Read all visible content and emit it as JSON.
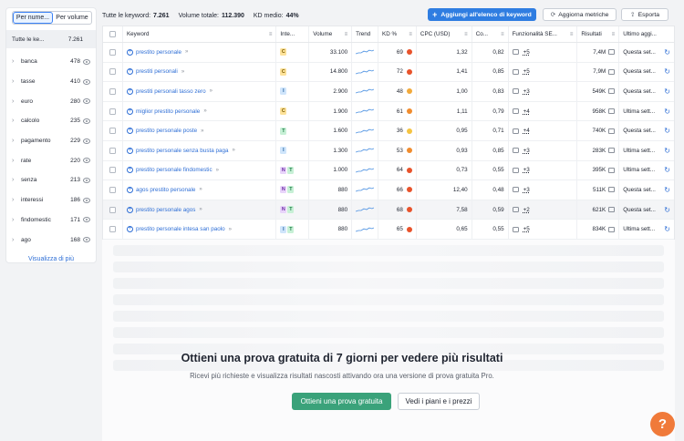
{
  "sidebar": {
    "tabs": [
      {
        "label": "Per nume..."
      },
      {
        "label": "Per volume"
      }
    ],
    "all_label": "Tutte le ke...",
    "all_count": "7.261",
    "items": [
      {
        "label": "banca",
        "count": "478"
      },
      {
        "label": "tasse",
        "count": "410"
      },
      {
        "label": "euro",
        "count": "280"
      },
      {
        "label": "calcolo",
        "count": "235"
      },
      {
        "label": "pagamento",
        "count": "229"
      },
      {
        "label": "rate",
        "count": "220"
      },
      {
        "label": "senza",
        "count": "213"
      },
      {
        "label": "interessi",
        "count": "186"
      },
      {
        "label": "findomestic",
        "count": "171"
      },
      {
        "label": "ago",
        "count": "168"
      }
    ],
    "more_label": "Visualizza di più"
  },
  "topbar": {
    "all_keywords_label": "Tutte le keyword:",
    "all_keywords_value": "7.261",
    "total_volume_label": "Volume totale:",
    "total_volume_value": "112.390",
    "kd_label": "KD medio:",
    "kd_value": "44%",
    "add_button": "Aggiungi all'elenco di keyword",
    "refresh_button": "Aggiorna metriche",
    "export_button": "Esporta"
  },
  "table": {
    "headers": {
      "keyword": "Keyword",
      "intent": "Inte...",
      "volume": "Volume",
      "trend": "Trend",
      "kd": "KD %",
      "cpc": "CPC (USD)",
      "competition": "Co...",
      "features": "Funzionalità SE...",
      "results": "Risultati",
      "updated": "Ultimo aggi..."
    },
    "rows": [
      {
        "keyword": "prestito personale",
        "intents": [
          "C"
        ],
        "volume": "33.100",
        "kd": "69",
        "kd_color": "#e8532b",
        "cpc": "1,32",
        "com": "0,82",
        "features": "+5",
        "results": "7,4M",
        "updated": "Questa set..."
      },
      {
        "keyword": "prestiti personali",
        "intents": [
          "C"
        ],
        "volume": "14.800",
        "kd": "72",
        "kd_color": "#e8532b",
        "cpc": "1,41",
        "com": "0,85",
        "features": "+5",
        "results": "7,9M",
        "updated": "Questa set..."
      },
      {
        "keyword": "prestiti personali tasso zero",
        "intents": [
          "I"
        ],
        "volume": "2.900",
        "kd": "48",
        "kd_color": "#f2a93b",
        "cpc": "1,00",
        "com": "0,83",
        "features": "+3",
        "results": "549K",
        "updated": "Questa set..."
      },
      {
        "keyword": "miglior prestito personale",
        "intents": [
          "C"
        ],
        "volume": "1.900",
        "kd": "61",
        "kd_color": "#f08c2e",
        "cpc": "1,11",
        "com": "0,79",
        "features": "+4",
        "results": "958K",
        "updated": "Ultima sett..."
      },
      {
        "keyword": "prestito personale poste",
        "intents": [
          "T"
        ],
        "volume": "1.600",
        "kd": "36",
        "kd_color": "#f5c342",
        "cpc": "0,95",
        "com": "0,71",
        "features": "+4",
        "results": "740K",
        "updated": "Questa set..."
      },
      {
        "keyword": "prestito personale senza busta paga",
        "intents": [
          "I"
        ],
        "volume": "1.300",
        "kd": "53",
        "kd_color": "#f08c2e",
        "cpc": "0,93",
        "com": "0,85",
        "features": "+3",
        "results": "283K",
        "updated": "Ultima sett..."
      },
      {
        "keyword": "prestito personale findomestic",
        "intents": [
          "N",
          "T"
        ],
        "volume": "1.000",
        "kd": "64",
        "kd_color": "#e8532b",
        "cpc": "0,73",
        "com": "0,55",
        "features": "+3",
        "results": "395K",
        "updated": "Ultima sett..."
      },
      {
        "keyword": "agos prestito personale",
        "intents": [
          "N",
          "T"
        ],
        "volume": "880",
        "kd": "66",
        "kd_color": "#e8532b",
        "cpc": "12,40",
        "com": "0,48",
        "features": "+3",
        "results": "511K",
        "updated": "Questa set..."
      },
      {
        "keyword": "prestito personale agos",
        "intents": [
          "N",
          "T"
        ],
        "volume": "880",
        "kd": "68",
        "kd_color": "#e8532b",
        "cpc": "7,58",
        "com": "0,59",
        "features": "+2",
        "results": "621K",
        "updated": "Questa set..."
      },
      {
        "keyword": "prestito personale intesa san paolo",
        "intents": [
          "I",
          "T"
        ],
        "volume": "880",
        "kd": "65",
        "kd_color": "#e8532b",
        "cpc": "0,65",
        "com": "0,55",
        "features": "+5",
        "results": "834K",
        "updated": "Ultima sett..."
      }
    ]
  },
  "cta": {
    "title": "Ottieni una prova gratuita di 7 giorni per vedere più risultati",
    "subtitle": "Ricevi più richieste e visualizza risultati nascosti attivando ora una versione di prova gratuita Pro.",
    "primary_button": "Ottieni una prova gratuita",
    "secondary_button": "Vedi i piani e i prezzi"
  },
  "help_label": "?",
  "colors": {
    "accent": "#2f7de1",
    "cta_green": "#3aa27a",
    "help_orange": "#f07a3a"
  }
}
